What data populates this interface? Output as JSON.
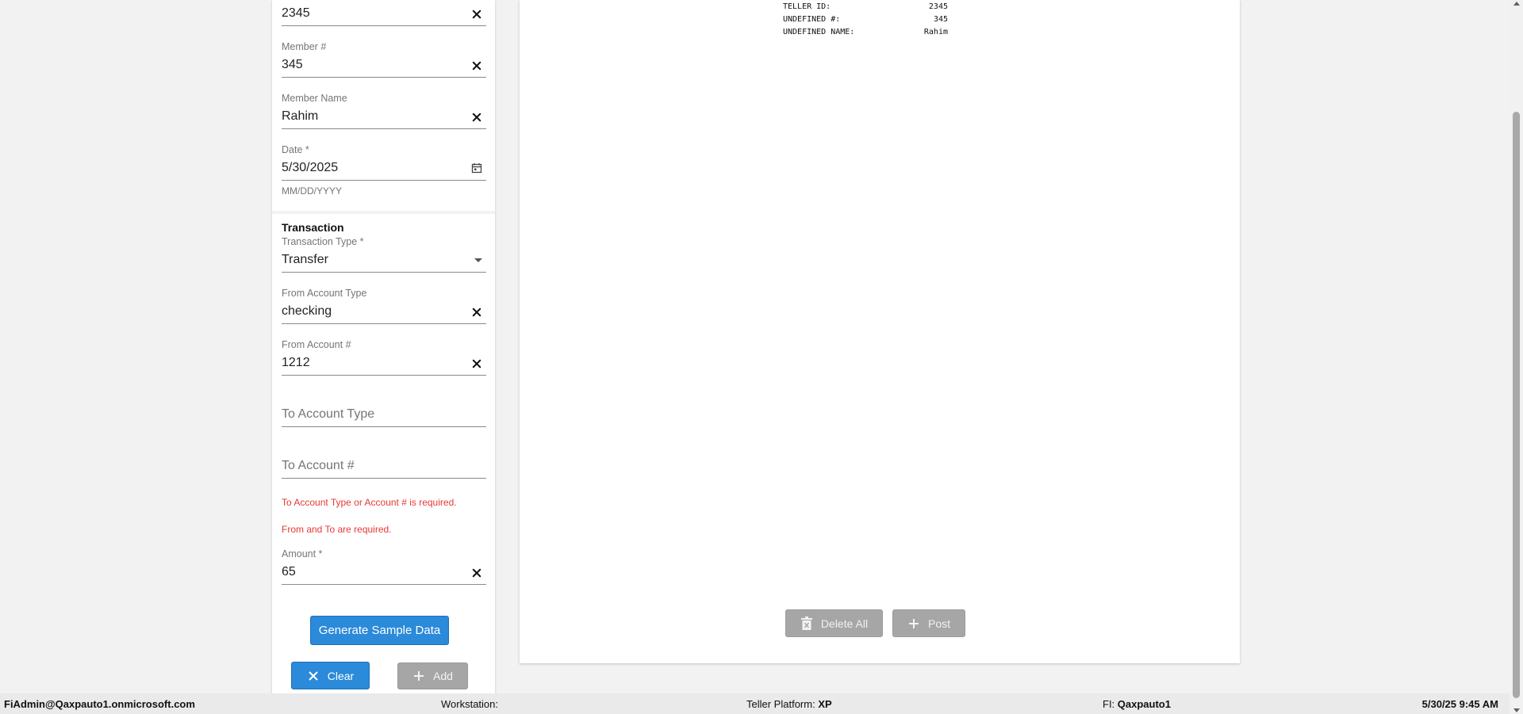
{
  "form": {
    "teller_id_value": "2345",
    "member_number": {
      "label": "Member #",
      "value": "345"
    },
    "member_name": {
      "label": "Member Name",
      "value": "Rahim"
    },
    "date": {
      "label": "Date *",
      "value": "5/30/2025",
      "hint": "MM/DD/YYYY"
    },
    "transaction": {
      "title": "Transaction",
      "type": {
        "label": "Transaction Type *",
        "value": "Transfer"
      },
      "from_account_type": {
        "label": "From Account Type",
        "value": "checking"
      },
      "from_account_number": {
        "label": "From Account #",
        "value": "1212"
      },
      "to_account_type": {
        "placeholder": "To Account Type"
      },
      "to_account_number": {
        "placeholder": "To Account #"
      },
      "errors": [
        "To Account Type or Account # is required.",
        "From and To are required."
      ],
      "amount": {
        "label": "Amount *",
        "value": "65"
      }
    },
    "generate_label": "Generate Sample Data",
    "clear_label": "Clear",
    "add_label": "Add"
  },
  "receipt": {
    "rows": [
      {
        "key": "TELLER ID:",
        "value": "2345"
      },
      {
        "key": "UNDEFINED #:",
        "value": "345"
      },
      {
        "key": "UNDEFINED NAME:",
        "value": "Rahim"
      }
    ],
    "delete_all_label": "Delete All",
    "post_label": "Post"
  },
  "status": {
    "user": "FiAdmin@Qaxpauto1.onmicrosoft.com",
    "workstation_label": "Workstation:",
    "workstation_value": "",
    "platform_label": "Teller Platform:",
    "platform_value": "XP",
    "fi_label": "FI:",
    "fi_value": "Qaxpauto1",
    "datetime": "5/30/25 9:45 AM"
  },
  "colors": {
    "primary": "#2b8ad9",
    "error": "#e53935",
    "disabled": "#a6a6a6"
  }
}
